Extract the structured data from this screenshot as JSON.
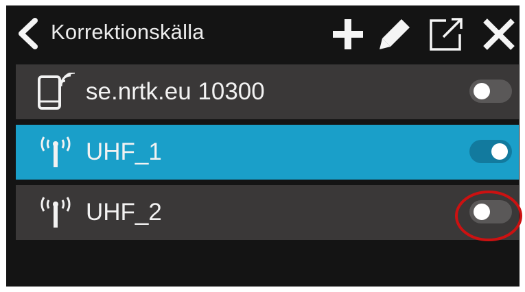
{
  "header": {
    "title": "Korrektionskälla",
    "icons": {
      "back": "chevron-left-icon",
      "add": "plus-icon",
      "edit": "pencil-icon",
      "export": "external-link-icon",
      "close": "close-icon"
    }
  },
  "sources": [
    {
      "label": "se.nrtk.eu 10300",
      "icon": "phone-signal-icon",
      "enabled": false,
      "selected": false
    },
    {
      "label": "UHF_1",
      "icon": "radio-antenna-icon",
      "enabled": true,
      "selected": true
    },
    {
      "label": "UHF_2",
      "icon": "radio-antenna-icon",
      "enabled": false,
      "selected": false
    }
  ],
  "colors": {
    "background": "#141414",
    "row": "#3a3838",
    "selected_row": "#1a9fc9",
    "toggle_on": "#127a9e",
    "toggle_off": "#5a5858",
    "highlight": "#cc1111"
  }
}
